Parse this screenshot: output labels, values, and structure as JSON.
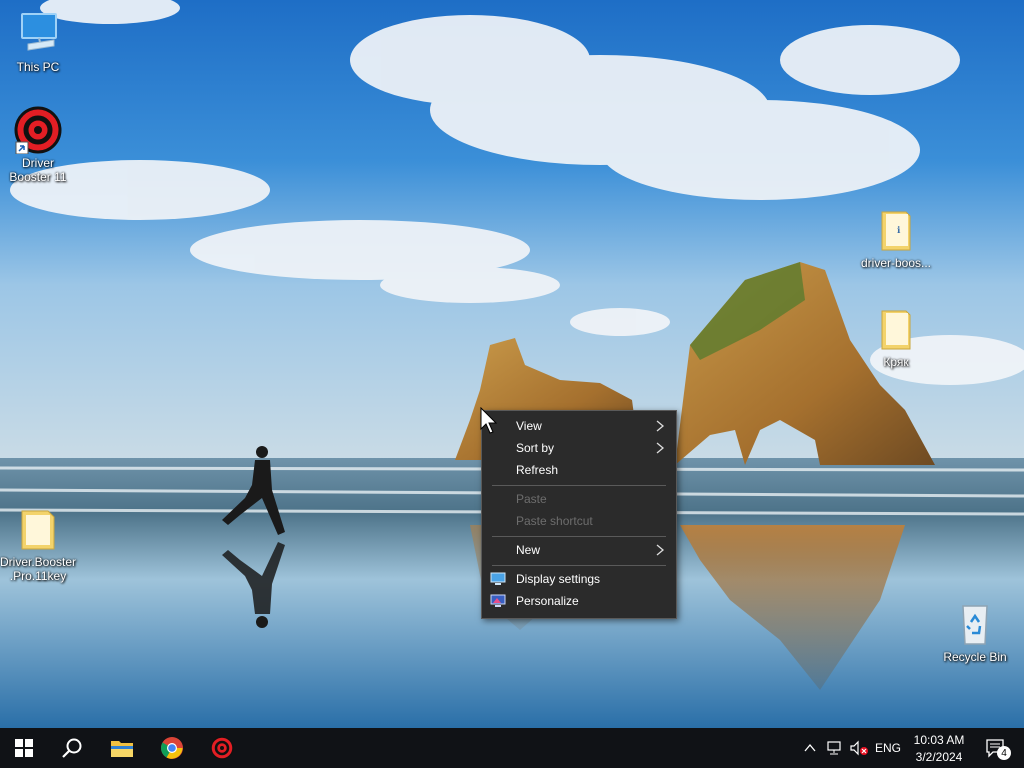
{
  "desktop": {
    "icons": [
      {
        "label": "This PC"
      },
      {
        "label": "Driver Booster 11"
      },
      {
        "label": "Driver.Booster .Pro.11key"
      },
      {
        "label": "driver-boos..."
      },
      {
        "label": "Кряк"
      },
      {
        "label": "Recycle Bin"
      }
    ]
  },
  "context_menu": {
    "view": "View",
    "sort_by": "Sort by",
    "refresh": "Refresh",
    "paste": "Paste",
    "paste_shortcut": "Paste shortcut",
    "new": "New",
    "display_settings": "Display settings",
    "personalize": "Personalize"
  },
  "taskbar": {
    "language": "ENG",
    "time": "10:03 AM",
    "date": "3/2/2024",
    "notification_count": "4",
    "accent": "#0078d7"
  }
}
